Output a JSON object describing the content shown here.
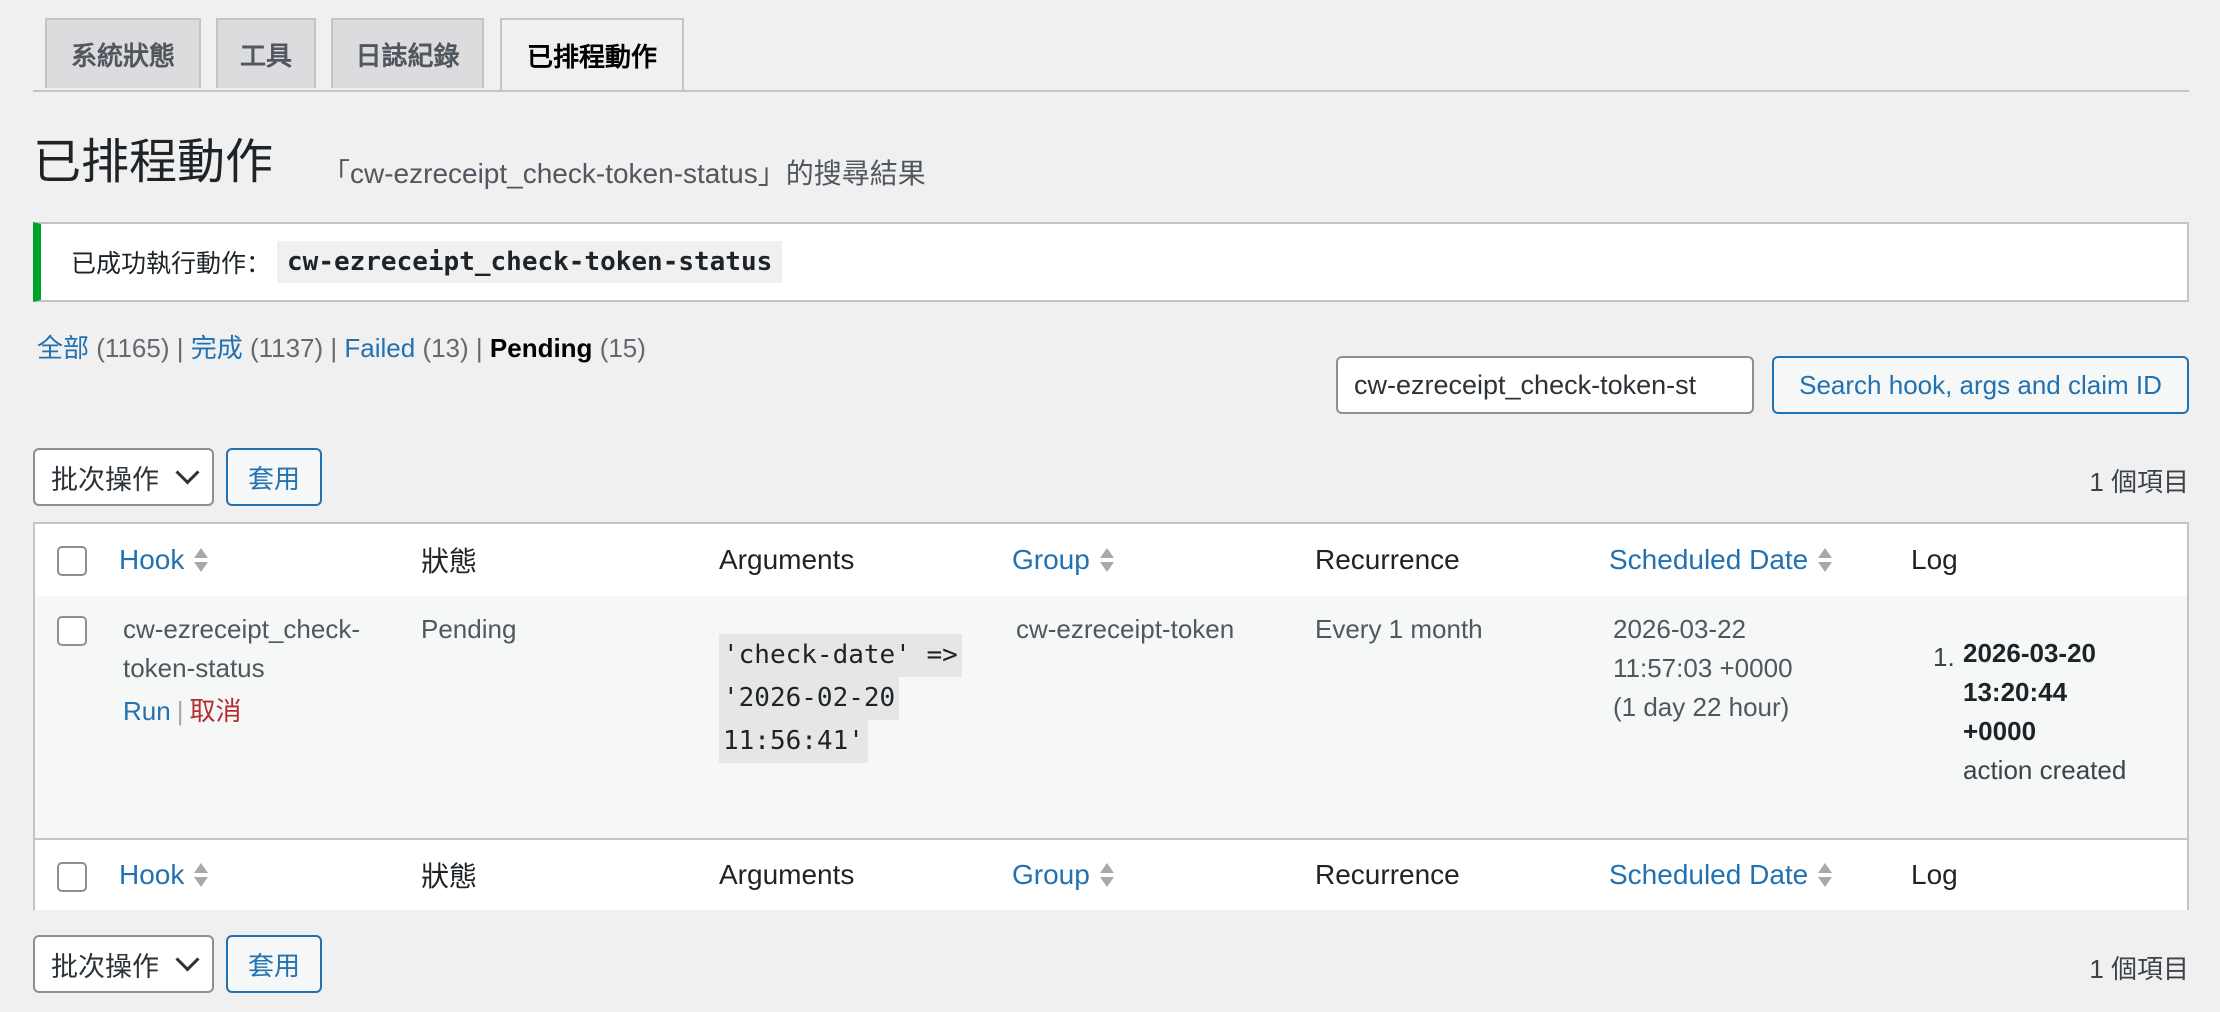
{
  "tabs": [
    {
      "label": "系統狀態"
    },
    {
      "label": "工具"
    },
    {
      "label": "日誌紀錄"
    },
    {
      "label": "已排程動作",
      "active": true
    }
  ],
  "page": {
    "title": "已排程動作",
    "subtitle": "「cw-ezreceipt_check-token-status」的搜尋結果"
  },
  "notice": {
    "text": "已成功執行動作：",
    "code": "cw-ezreceipt_check-token-status"
  },
  "filters": [
    {
      "label": "全部",
      "count": "(1165)"
    },
    {
      "label": "完成",
      "count": "(1137)"
    },
    {
      "label": "Failed",
      "count": "(13)"
    },
    {
      "label": "Pending",
      "count": "(15)",
      "current": true
    }
  ],
  "search": {
    "value": "cw-ezreceipt_check-token-st",
    "button": "Search hook, args and claim ID"
  },
  "bulk": {
    "select": "批次操作",
    "apply": "套用",
    "count": "1 個項目"
  },
  "columns": {
    "hook": "Hook",
    "status": "狀態",
    "arguments": "Arguments",
    "group": "Group",
    "recurrence": "Recurrence",
    "scheduled": "Scheduled Date",
    "log": "Log"
  },
  "rows": [
    {
      "hook_line1": "cw-ezreceipt_check-",
      "hook_line2": "token-status",
      "action_run": "Run",
      "action_cancel": "取消",
      "status": "Pending",
      "args_line1": " 'check-date' =>",
      "args_line2": "'2026-02-20",
      "args_line3": "11:56:41'",
      "group": "cw-ezreceipt-token",
      "recurrence": "Every 1 month",
      "scheduled_line1": "2026-03-22",
      "scheduled_line2": "11:57:03 +0000",
      "scheduled_line3": "(1 day 22 hour)",
      "log_num": "1.",
      "log_line1": "2026-03-20",
      "log_line2": "13:20:44",
      "log_line3": "+0000",
      "log_line4": "action created"
    }
  ]
}
